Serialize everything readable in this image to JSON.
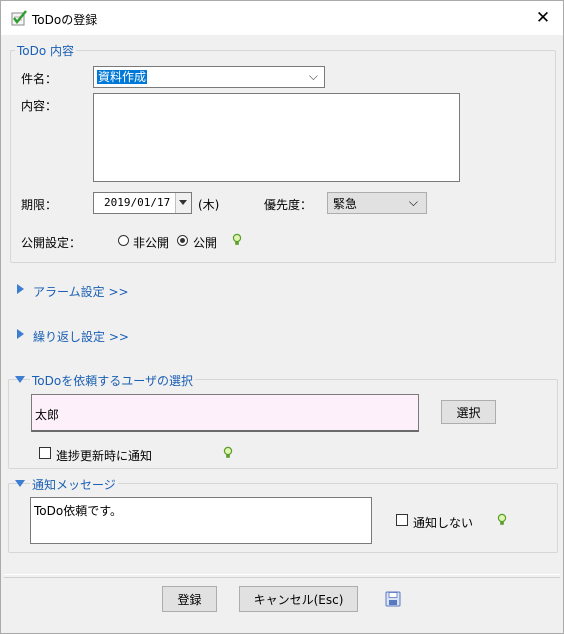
{
  "window": {
    "title": "ToDoの登録",
    "close": "✕"
  },
  "todo_content": {
    "legend": "ToDo 内容",
    "subject_label": "件名：",
    "subject_value": "資料作成",
    "content_label": "内容：",
    "content_value": "",
    "due_label": "期限：",
    "due_date": "2019/01/17",
    "due_weekday": "(木)",
    "priority_label": "優先度：",
    "priority_value": "緊急",
    "publish_label": "公開設定：",
    "publish_options": [
      "非公開",
      "公開"
    ],
    "publish_selected": "公開"
  },
  "alarm": {
    "label": "アラーム設定 >>"
  },
  "repeat": {
    "label": "繰り返し設定 >>"
  },
  "user_select": {
    "legend": "ToDoを依頼するユーザの選択",
    "user_value": "太郎",
    "select_button": "選択",
    "notify_progress_label": "進捗更新時に通知",
    "notify_progress_checked": false
  },
  "notify_message": {
    "legend": "通知メッセージ",
    "message_value": "ToDo依頼です。",
    "no_notify_label": "通知しない",
    "no_notify_checked": false
  },
  "footer": {
    "register_button": "登録",
    "cancel_button": "キャンセル(Esc)"
  },
  "icons": {
    "app": "checkmark-notepad-icon",
    "hint": "lightbulb-icon",
    "save": "floppy-disk-icon"
  }
}
